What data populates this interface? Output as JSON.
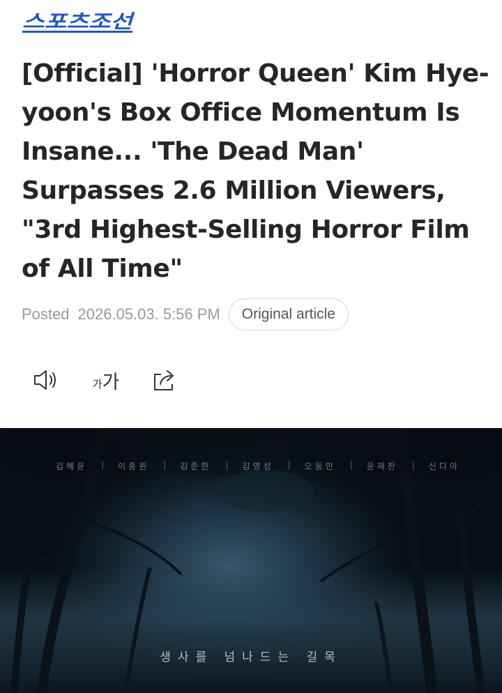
{
  "header": {
    "logo_text": "스포츠조선"
  },
  "article": {
    "title": "[Official] 'Horror Queen' Kim Hye-yoon's Box Office Momentum Is Insane... 'The Dead Man' Surpasses 2.6 Million Viewers, \"3rd Highest-Selling Horror Film of All Time\"",
    "posted_label": "Posted",
    "posted_date": "2026.05.03. 5:56 PM",
    "original_article_label": "Original article"
  },
  "toolbar": {
    "font_small": "가",
    "font_big": "가",
    "icons": [
      "speaker-icon",
      "font-size-icon",
      "share-icon"
    ]
  },
  "poster": {
    "cast": [
      "김혜윤",
      "이종원",
      "김준한",
      "김영성",
      "오동민",
      "윤재찬",
      "신디아"
    ],
    "tagline": "생사를 넘나드는 길목"
  },
  "colors": {
    "logo_blue": "#1f57c8",
    "headline": "#262626",
    "meta_gray": "#9a9a9a"
  }
}
